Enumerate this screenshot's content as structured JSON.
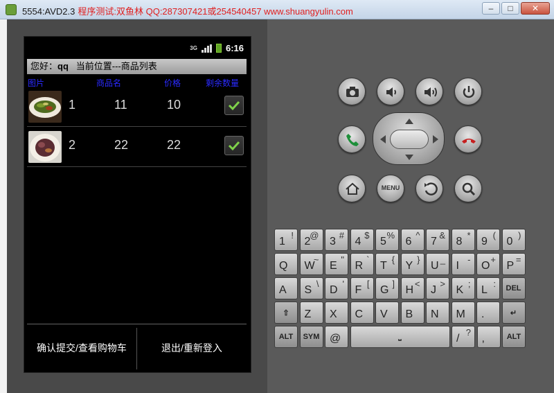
{
  "window": {
    "title": "5554:AVD2.3",
    "program_text": "程序测试:双鱼林 QQ:287307421或254540457 www.shuangyulin.com",
    "minimize": "–",
    "maximize": "□",
    "close": "✕"
  },
  "status_bar": {
    "network": "3G",
    "time": "6:16"
  },
  "header": {
    "greeting": "您好：",
    "user": "qq",
    "location": "当前位置---商品列表"
  },
  "columns": [
    "图片",
    "商品名",
    "价格",
    "剩余数量"
  ],
  "rows": [
    {
      "name": "1",
      "price": "11",
      "stock": "10",
      "checked": true,
      "image": "dish-green-vegetables"
    },
    {
      "name": "2",
      "price": "22",
      "stock": "22",
      "checked": true,
      "image": "dish-braised-eggplant"
    }
  ],
  "bottom_buttons": {
    "confirm": "确认提交/查看购物车",
    "logout": "退出/重新登入"
  },
  "hardware_buttons": [
    "camera-icon",
    "volume-down-icon",
    "volume-up-icon",
    "power-icon",
    "call-icon",
    "end-call-icon",
    "home-icon",
    "MENU",
    "back-icon",
    "search-icon"
  ],
  "keyboard": {
    "row1": [
      [
        "1",
        "!"
      ],
      [
        "2",
        "@"
      ],
      [
        "3",
        "#"
      ],
      [
        "4",
        "$"
      ],
      [
        "5",
        "%"
      ],
      [
        "6",
        "^"
      ],
      [
        "7",
        "&"
      ],
      [
        "8",
        "*"
      ],
      [
        "9",
        "("
      ],
      [
        "0",
        ")"
      ]
    ],
    "row2": [
      [
        "Q",
        ""
      ],
      [
        "W",
        "~"
      ],
      [
        "E",
        "\""
      ],
      [
        "R",
        "`"
      ],
      [
        "T",
        "{"
      ],
      [
        "Y",
        "}"
      ],
      [
        "U",
        "_"
      ],
      [
        "I",
        "-"
      ],
      [
        "O",
        "+"
      ],
      [
        "P",
        "="
      ]
    ],
    "row3": [
      [
        "A",
        ""
      ],
      [
        "S",
        "\\"
      ],
      [
        "D",
        "'"
      ],
      [
        "F",
        "["
      ],
      [
        "G",
        "]"
      ],
      [
        "H",
        "<"
      ],
      [
        "J",
        ">"
      ],
      [
        "K",
        ";"
      ],
      [
        "L",
        ":"
      ],
      [
        "DEL",
        ""
      ]
    ],
    "row4": [
      [
        "⇧",
        ""
      ],
      [
        "Z",
        ""
      ],
      [
        "X",
        ""
      ],
      [
        "C",
        ""
      ],
      [
        "V",
        ""
      ],
      [
        "B",
        ""
      ],
      [
        "N",
        ""
      ],
      [
        "M",
        ""
      ],
      [
        ".",
        ""
      ],
      [
        "↵",
        ""
      ]
    ],
    "row5": [
      [
        "ALT",
        ""
      ],
      [
        "SYM",
        ""
      ],
      [
        "@",
        ""
      ],
      [
        "space",
        ""
      ],
      [
        "/",
        "?"
      ],
      [
        ",",
        ""
      ],
      [
        "ALT",
        ""
      ]
    ]
  },
  "colors": {
    "accent_blue": "#2a2aff",
    "check_green": "#7fd14a",
    "title_red": "#e02020"
  }
}
